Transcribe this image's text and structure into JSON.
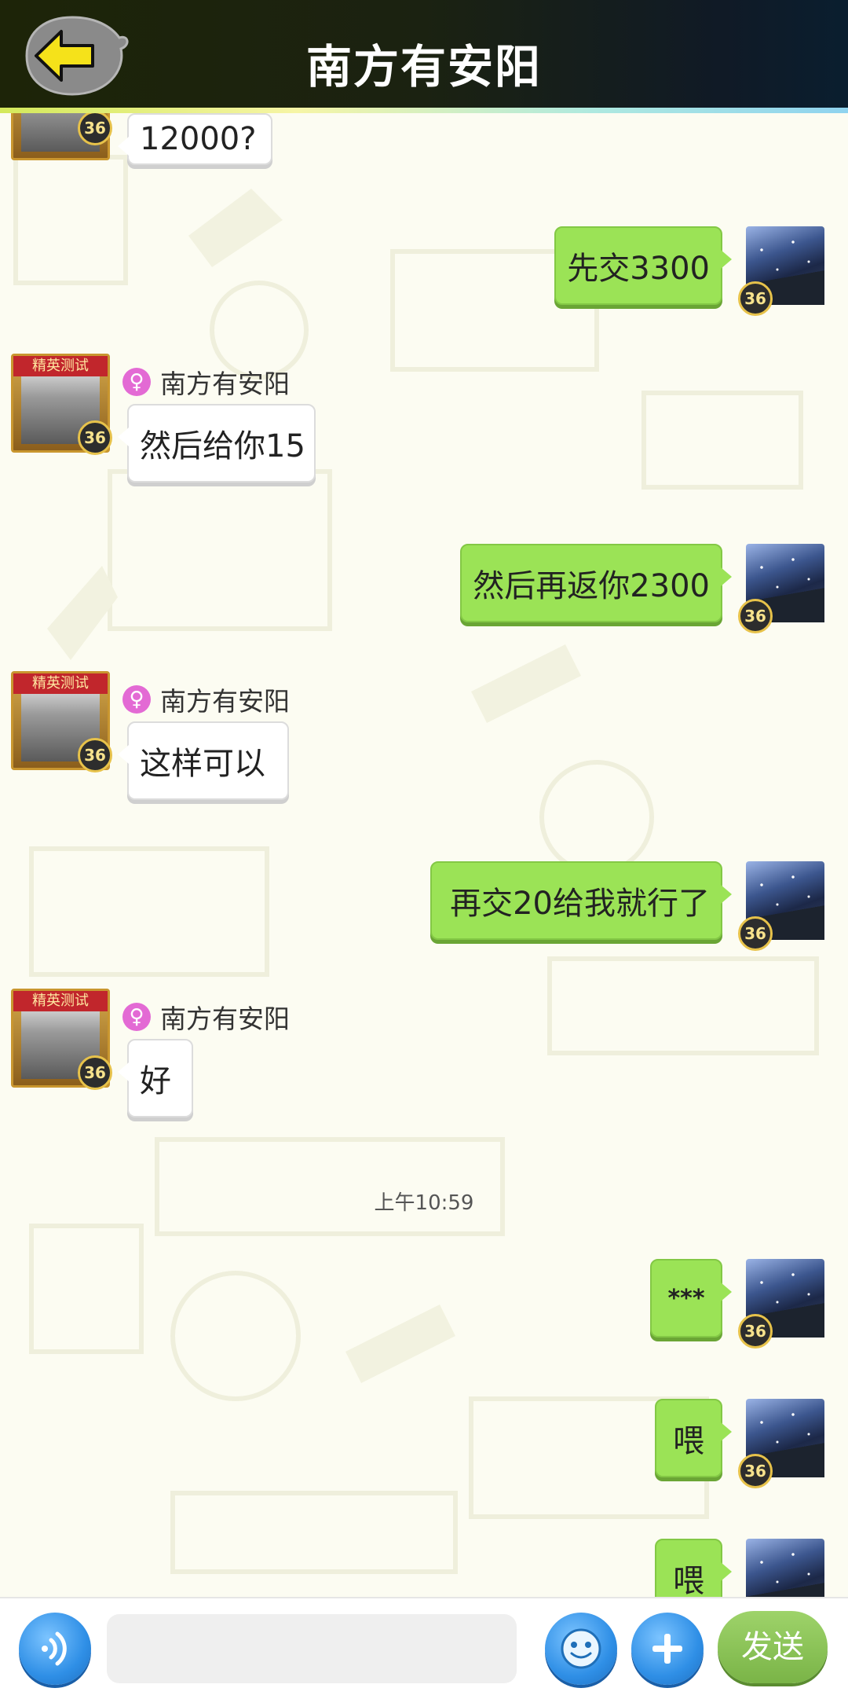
{
  "header": {
    "title": "南方有安阳",
    "back_icon": "back-arrow-icon"
  },
  "contact": {
    "name": "南方有安阳",
    "level": "36",
    "avatar_ribbon": "精英测试",
    "gender_icon": "female-icon"
  },
  "self": {
    "level": "36"
  },
  "messages": [
    {
      "from": "them",
      "text": "12000?"
    },
    {
      "from": "me",
      "text": "先交3300"
    },
    {
      "from": "them",
      "sender": "南方有安阳",
      "text": "然后给你15"
    },
    {
      "from": "me",
      "text": "然后再返你2300"
    },
    {
      "from": "them",
      "sender": "南方有安阳",
      "text": "这样可以"
    },
    {
      "from": "me",
      "text": "再交20给我就行了"
    },
    {
      "from": "them",
      "sender": "南方有安阳",
      "text": "好"
    },
    {
      "from": "me",
      "text": "***"
    },
    {
      "from": "me",
      "text": "喂"
    },
    {
      "from": "me",
      "text": "喂"
    }
  ],
  "timestamp": "上午10:59",
  "input": {
    "value": "",
    "placeholder": ""
  },
  "bottom": {
    "voice_icon": "voice-icon",
    "emoji_icon": "emoji-icon",
    "plus_icon": "plus-icon",
    "send_label": "发送"
  },
  "colors": {
    "my_bubble": "#9be356",
    "their_bubble": "#ffffff",
    "send_button": "#8cc454",
    "round_buttons": "#2f8fe6"
  }
}
